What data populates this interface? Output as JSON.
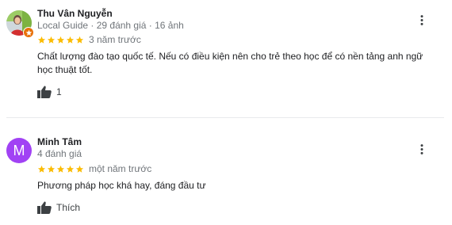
{
  "colors": {
    "star": "#fbbc04",
    "text_primary": "#202124",
    "text_secondary": "#70757a",
    "avatar_letter_bg": "#a142f4",
    "local_guide_badge": "#e8710a",
    "divider": "#e8eaed"
  },
  "reviews": [
    {
      "author": "Thu Vân Nguyễn",
      "avatar_type": "photo",
      "badge_icon": "local-guide-star-icon",
      "meta": "Local Guide · 29 đánh giá · 16 ảnh",
      "rating": 5,
      "time": "3 năm trước",
      "text": "Chất lượng đào tạo quốc tế. Nếu có điều kiện nên cho trẻ theo học để có nền tảng anh ngữ học thuật tốt.",
      "like_label": "1",
      "more_icon": "more-vert-icon"
    },
    {
      "author": "Minh Tâm",
      "avatar_type": "letter",
      "avatar_letter": "M",
      "meta": "4 đánh giá",
      "rating": 5,
      "time": "một năm trước",
      "text": "Phương pháp học khá hay, đáng đầu tư",
      "like_label": "Thích",
      "more_icon": "more-vert-icon"
    }
  ]
}
